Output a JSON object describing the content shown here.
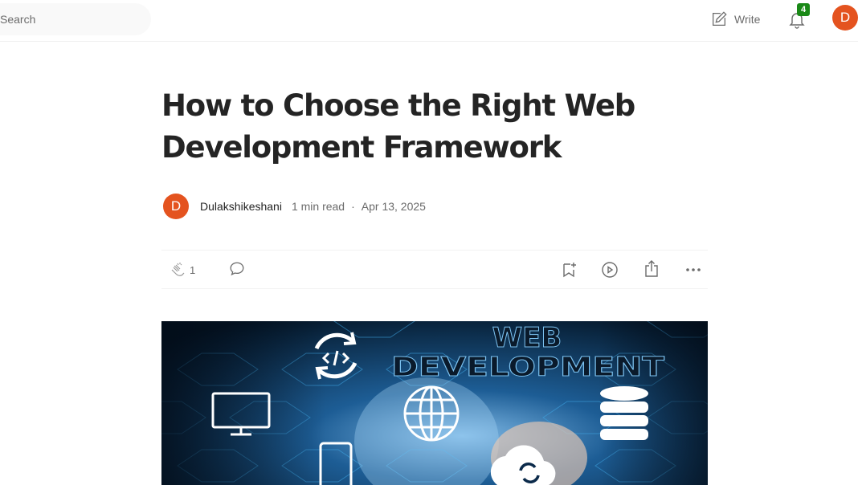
{
  "header": {
    "search_placeholder": "Search",
    "write_label": "Write",
    "notification_count": "4",
    "avatar_initial": "D"
  },
  "article": {
    "title": "How to Choose the Right Web Development Framework",
    "author": {
      "initial": "D",
      "name": "Dulakshikeshani"
    },
    "read_time": "1 min read",
    "separator": "·",
    "date": "Apr 13, 2025",
    "clap_count": "1",
    "hero_image": {
      "line1": "WEB",
      "line2": "DEVELOPMENT"
    }
  },
  "colors": {
    "avatar": "#e4531f",
    "badge": "#1a8917",
    "text_primary": "#242424",
    "text_secondary": "#6b6b6b"
  },
  "icons": [
    "write-icon",
    "bell-icon",
    "clap-icon",
    "comment-icon",
    "bookmark-add-icon",
    "play-icon",
    "share-icon",
    "more-icon"
  ]
}
